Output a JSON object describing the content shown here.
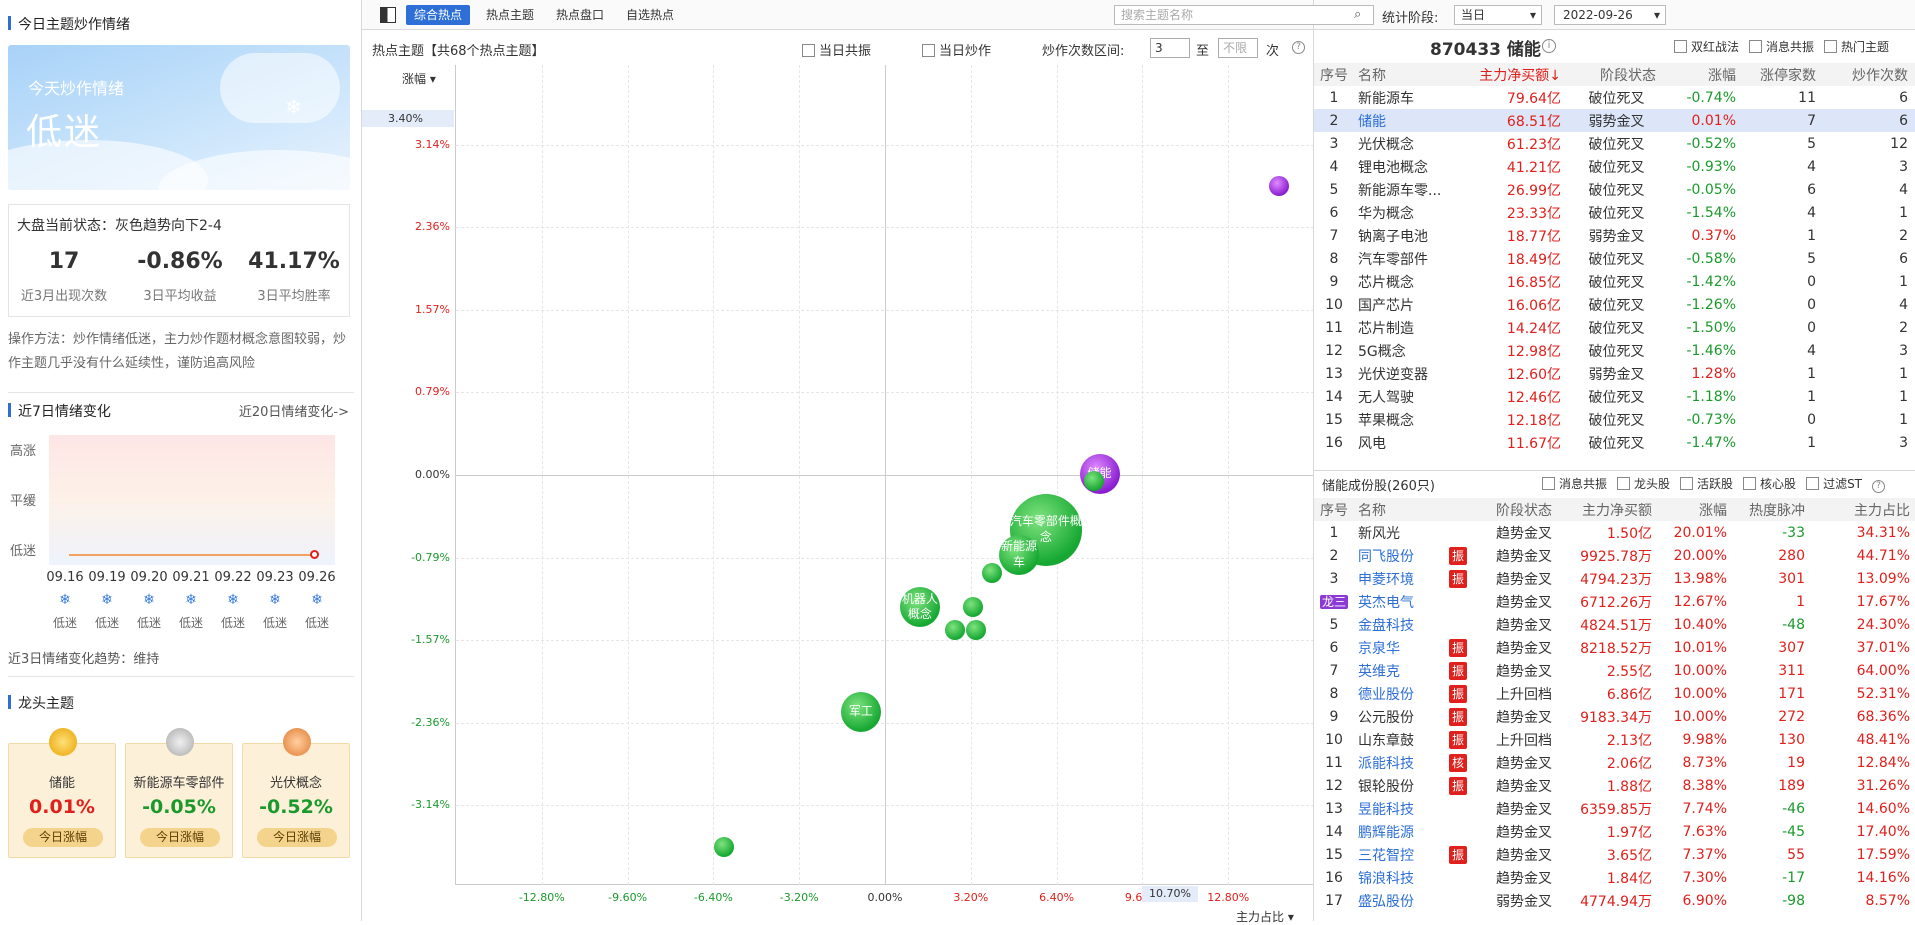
{
  "left": {
    "title": "今日主题炒作情绪",
    "hero_sub": "今天炒作情绪",
    "hero_main": "低迷",
    "market_status": "大盘当前状态：灰色趋势向下2-4",
    "stats": [
      {
        "value": "17",
        "label": "近3月出现次数"
      },
      {
        "value": "-0.86%",
        "label": "3日平均收益"
      },
      {
        "value": "41.17%",
        "label": "3日平均胜率"
      }
    ],
    "method": "操作方法：炒作情绪低迷，主力炒作题材概念意图较弱，炒作主题几乎没有什么延续性，谨防追高风险",
    "week_title": "近7日情绪变化",
    "week_link": "近20日情绪变化->",
    "levels": [
      "高涨",
      "平缓",
      "低迷"
    ],
    "dates": [
      "09.16",
      "09.19",
      "09.20",
      "09.21",
      "09.22",
      "09.23",
      "09.26"
    ],
    "moods": [
      "低迷",
      "低迷",
      "低迷",
      "低迷",
      "低迷",
      "低迷",
      "低迷"
    ],
    "trend": "近3日情绪变化趋势：维持",
    "dragon_title": "龙头主题",
    "dragons": [
      {
        "name": "储能",
        "pct": "0.01%",
        "btn": "今日涨幅",
        "color": "#e0201c"
      },
      {
        "name": "新能源车零部件",
        "pct": "-0.05%",
        "btn": "今日涨幅",
        "color": "#1a9a2c"
      },
      {
        "name": "光伏概念",
        "pct": "-0.52%",
        "btn": "今日涨幅",
        "color": "#1a9a2c"
      }
    ]
  },
  "mid": {
    "tabs": [
      "综合热点",
      "热点主题",
      "热点盘口",
      "自选热点"
    ],
    "search_placeholder": "搜索主题名称",
    "stat_label": "统计阶段:",
    "stat_value": "当日",
    "date": "2022-09-26",
    "chart_title": "热点主题【共68个热点主题】",
    "opt1": "当日共振",
    "opt2": "当日炒作",
    "range_label": "炒作次数区间:",
    "range_from": "3",
    "range_to_sep": "至",
    "range_to_ph": "不限",
    "range_unit": "次",
    "y_sort": "涨幅",
    "x_sort": "主力占比",
    "y_marker": "3.40%",
    "x_marker": "10.70%"
  },
  "chart_data": {
    "type": "scatter",
    "xlabel": "主力占比",
    "ylabel": "涨幅",
    "x_ticks": [
      "-12.80%",
      "-9.60%",
      "-6.40%",
      "-3.20%",
      "0.00%",
      "3.20%",
      "6.40%",
      "9.60%",
      "12.80%"
    ],
    "y_ticks": [
      "3.14%",
      "2.36%",
      "1.57%",
      "0.79%",
      "0.00%",
      "-0.79%",
      "-1.57%",
      "-2.36%",
      "-3.14%"
    ],
    "xlim": [
      -16,
      16
    ],
    "ylim": [
      -3.9,
      3.9
    ],
    "points": [
      {
        "label": "",
        "x": 14.7,
        "y": 2.75,
        "r": 10,
        "color": "purple"
      },
      {
        "label": "储能",
        "x": 8.0,
        "y": 0.01,
        "r": 20,
        "color": "purple"
      },
      {
        "label": "",
        "x": 7.8,
        "y": -0.06,
        "r": 10,
        "color": "green"
      },
      {
        "label": "汽车零部件概念",
        "x": 6.0,
        "y": -0.52,
        "r": 36,
        "color": "green"
      },
      {
        "label": "新能源车",
        "x": 5.0,
        "y": -0.76,
        "r": 20,
        "color": "green"
      },
      {
        "label": "",
        "x": 4.0,
        "y": -0.93,
        "r": 10,
        "color": "green"
      },
      {
        "label": "机器人概念",
        "x": 1.3,
        "y": -1.26,
        "r": 20,
        "color": "green"
      },
      {
        "label": "",
        "x": 3.3,
        "y": -1.26,
        "r": 10,
        "color": "green"
      },
      {
        "label": "",
        "x": 2.6,
        "y": -1.47,
        "r": 10,
        "color": "green"
      },
      {
        "label": "",
        "x": 3.4,
        "y": -1.47,
        "r": 10,
        "color": "green"
      },
      {
        "label": "军工",
        "x": -0.9,
        "y": -2.25,
        "r": 20,
        "color": "green"
      },
      {
        "label": "",
        "x": -6.0,
        "y": -3.54,
        "r": 10,
        "color": "green"
      }
    ]
  },
  "right": {
    "head_code_name": "870433 储能",
    "opts": [
      "双红战法",
      "消息共振",
      "热门主题"
    ],
    "top_headers": [
      "序号",
      "名称",
      "主力净买额↓",
      "阶段状态",
      "涨幅",
      "涨停家数",
      "炒作次数"
    ],
    "top_rows": [
      [
        "1",
        "新能源车",
        "79.64亿",
        "破位死叉",
        "-0.74%",
        "11",
        "6"
      ],
      [
        "2",
        "储能",
        "68.51亿",
        "弱势金叉",
        "0.01%",
        "7",
        "6"
      ],
      [
        "3",
        "光伏概念",
        "61.23亿",
        "破位死叉",
        "-0.52%",
        "5",
        "12"
      ],
      [
        "4",
        "锂电池概念",
        "41.21亿",
        "破位死叉",
        "-0.93%",
        "4",
        "3"
      ],
      [
        "5",
        "新能源车零...",
        "26.99亿",
        "破位死叉",
        "-0.05%",
        "6",
        "4"
      ],
      [
        "6",
        "华为概念",
        "23.33亿",
        "破位死叉",
        "-1.54%",
        "4",
        "1"
      ],
      [
        "7",
        "钠离子电池",
        "18.77亿",
        "弱势金叉",
        "0.37%",
        "1",
        "2"
      ],
      [
        "8",
        "汽车零部件",
        "18.49亿",
        "破位死叉",
        "-0.58%",
        "5",
        "6"
      ],
      [
        "9",
        "芯片概念",
        "16.85亿",
        "破位死叉",
        "-1.42%",
        "0",
        "1"
      ],
      [
        "10",
        "国产芯片",
        "16.06亿",
        "破位死叉",
        "-1.26%",
        "0",
        "4"
      ],
      [
        "11",
        "芯片制造",
        "14.24亿",
        "破位死叉",
        "-1.50%",
        "0",
        "2"
      ],
      [
        "12",
        "5G概念",
        "12.98亿",
        "破位死叉",
        "-1.46%",
        "4",
        "3"
      ],
      [
        "13",
        "光伏逆变器",
        "12.60亿",
        "弱势金叉",
        "1.28%",
        "1",
        "1"
      ],
      [
        "14",
        "无人驾驶",
        "12.46亿",
        "破位死叉",
        "-1.18%",
        "1",
        "1"
      ],
      [
        "15",
        "苹果概念",
        "12.18亿",
        "破位死叉",
        "-0.73%",
        "0",
        "1"
      ],
      [
        "16",
        "风电",
        "11.67亿",
        "破位死叉",
        "-1.47%",
        "1",
        "3"
      ]
    ],
    "sub_title": "储能成份股(260只)",
    "sub_opts": [
      "消息共振",
      "龙头股",
      "活跃股",
      "核心股",
      "过滤ST"
    ],
    "bot_headers": [
      "序号",
      "名称",
      "阶段状态",
      "主力净买额",
      "涨幅",
      "热度脉冲",
      "主力占比"
    ],
    "bot_rows": [
      {
        "no": "1",
        "name": "新风光",
        "tag": "",
        "stage": "趋势金叉",
        "buy": "1.50亿",
        "pct": "20.01%",
        "heat": "-33",
        "ratio": "34.31%",
        "blue": false
      },
      {
        "no": "2",
        "name": "同飞股份",
        "tag": "振",
        "stage": "趋势金叉",
        "buy": "9925.78万",
        "pct": "20.00%",
        "heat": "280",
        "ratio": "44.71%",
        "blue": true
      },
      {
        "no": "3",
        "name": "申菱环境",
        "tag": "振",
        "stage": "趋势金叉",
        "buy": "4794.23万",
        "pct": "13.98%",
        "heat": "301",
        "ratio": "13.09%",
        "blue": true
      },
      {
        "no": "龙三",
        "name": "英杰电气",
        "tag": "",
        "stage": "趋势金叉",
        "buy": "6712.26万",
        "pct": "12.67%",
        "heat": "1",
        "ratio": "17.67%",
        "blue": true
      },
      {
        "no": "5",
        "name": "金盘科技",
        "tag": "",
        "stage": "趋势金叉",
        "buy": "4824.51万",
        "pct": "10.40%",
        "heat": "-48",
        "ratio": "24.30%",
        "blue": true
      },
      {
        "no": "6",
        "name": "京泉华",
        "tag": "振",
        "stage": "趋势金叉",
        "buy": "8218.52万",
        "pct": "10.01%",
        "heat": "307",
        "ratio": "37.01%",
        "blue": true
      },
      {
        "no": "7",
        "name": "英维克",
        "tag": "振",
        "stage": "趋势金叉",
        "buy": "2.55亿",
        "pct": "10.00%",
        "heat": "311",
        "ratio": "64.00%",
        "blue": true
      },
      {
        "no": "8",
        "name": "德业股份",
        "tag": "振",
        "stage": "上升回档",
        "buy": "6.86亿",
        "pct": "10.00%",
        "heat": "171",
        "ratio": "52.31%",
        "blue": true
      },
      {
        "no": "9",
        "name": "公元股份",
        "tag": "振",
        "stage": "趋势金叉",
        "buy": "9183.34万",
        "pct": "10.00%",
        "heat": "272",
        "ratio": "68.36%",
        "blue": false
      },
      {
        "no": "10",
        "name": "山东章鼓",
        "tag": "振",
        "stage": "上升回档",
        "buy": "2.13亿",
        "pct": "9.98%",
        "heat": "130",
        "ratio": "48.41%",
        "blue": false
      },
      {
        "no": "11",
        "name": "派能科技",
        "tag": "核",
        "stage": "趋势金叉",
        "buy": "2.06亿",
        "pct": "8.73%",
        "heat": "19",
        "ratio": "12.84%",
        "blue": true
      },
      {
        "no": "12",
        "name": "银轮股份",
        "tag": "振",
        "stage": "趋势金叉",
        "buy": "1.88亿",
        "pct": "8.38%",
        "heat": "189",
        "ratio": "31.26%",
        "blue": false
      },
      {
        "no": "13",
        "name": "昱能科技",
        "tag": "",
        "stage": "趋势金叉",
        "buy": "6359.85万",
        "pct": "7.74%",
        "heat": "-46",
        "ratio": "14.60%",
        "blue": true
      },
      {
        "no": "14",
        "name": "鹏辉能源",
        "tag": "",
        "stage": "趋势金叉",
        "buy": "1.97亿",
        "pct": "7.63%",
        "heat": "-45",
        "ratio": "17.40%",
        "blue": true
      },
      {
        "no": "15",
        "name": "三花智控",
        "tag": "振",
        "stage": "趋势金叉",
        "buy": "3.65亿",
        "pct": "7.37%",
        "heat": "55",
        "ratio": "17.59%",
        "blue": true
      },
      {
        "no": "16",
        "name": "锦浪科技",
        "tag": "",
        "stage": "趋势金叉",
        "buy": "1.84亿",
        "pct": "7.30%",
        "heat": "-17",
        "ratio": "14.16%",
        "blue": true
      },
      {
        "no": "17",
        "name": "盛弘股份",
        "tag": "",
        "stage": "弱势金叉",
        "buy": "4774.94万",
        "pct": "6.90%",
        "heat": "-98",
        "ratio": "8.57%",
        "blue": true
      }
    ]
  }
}
